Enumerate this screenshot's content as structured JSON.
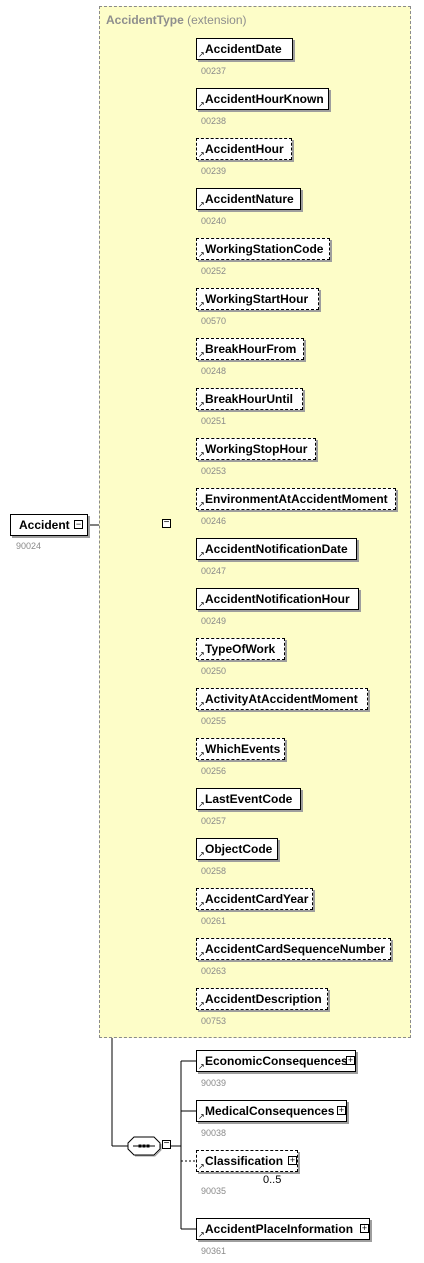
{
  "type_title": {
    "name": "AccidentType",
    "suffix": "(extension)"
  },
  "root": {
    "name": "Accident",
    "code": "90024"
  },
  "type_elements": [
    {
      "name": "AccidentDate",
      "code": "00237",
      "optional": false
    },
    {
      "name": "AccidentHourKnown",
      "code": "00238",
      "optional": false
    },
    {
      "name": "AccidentHour",
      "code": "00239",
      "optional": true
    },
    {
      "name": "AccidentNature",
      "code": "00240",
      "optional": false
    },
    {
      "name": "WorkingStationCode",
      "code": "00252",
      "optional": true
    },
    {
      "name": "WorkingStartHour",
      "code": "00570",
      "optional": true
    },
    {
      "name": "BreakHourFrom",
      "code": "00248",
      "optional": true
    },
    {
      "name": "BreakHourUntil",
      "code": "00251",
      "optional": true
    },
    {
      "name": "WorkingStopHour",
      "code": "00253",
      "optional": true
    },
    {
      "name": "EnvironmentAtAccidentMoment",
      "code": "00246",
      "optional": true
    },
    {
      "name": "AccidentNotificationDate",
      "code": "00247",
      "optional": false
    },
    {
      "name": "AccidentNotificationHour",
      "code": "00249",
      "optional": false
    },
    {
      "name": "TypeOfWork",
      "code": "00250",
      "optional": true
    },
    {
      "name": "ActivityAtAccidentMoment",
      "code": "00255",
      "optional": true
    },
    {
      "name": "WhichEvents",
      "code": "00256",
      "optional": true
    },
    {
      "name": "LastEventCode",
      "code": "00257",
      "optional": false
    },
    {
      "name": "ObjectCode",
      "code": "00258",
      "optional": false
    },
    {
      "name": "AccidentCardYear",
      "code": "00261",
      "optional": true
    },
    {
      "name": "AccidentCardSequenceNumber",
      "code": "00263",
      "optional": true
    },
    {
      "name": "AccidentDescription",
      "code": "00753",
      "optional": true
    }
  ],
  "extension_elements": [
    {
      "name": "EconomicConsequences",
      "code": "90039",
      "optional": false,
      "cardinality": ""
    },
    {
      "name": "MedicalConsequences",
      "code": "90038",
      "optional": false,
      "cardinality": ""
    },
    {
      "name": "Classification",
      "code": "90035",
      "optional": true,
      "cardinality": "0..5"
    },
    {
      "name": "AccidentPlaceInformation",
      "code": "90361",
      "optional": false,
      "cardinality": ""
    }
  ],
  "colors": {
    "type_fill": "#fdfdc8",
    "type_border": "#8a8a8a",
    "code_text": "#8a8a8a",
    "shadow": "#9e9e9e"
  }
}
